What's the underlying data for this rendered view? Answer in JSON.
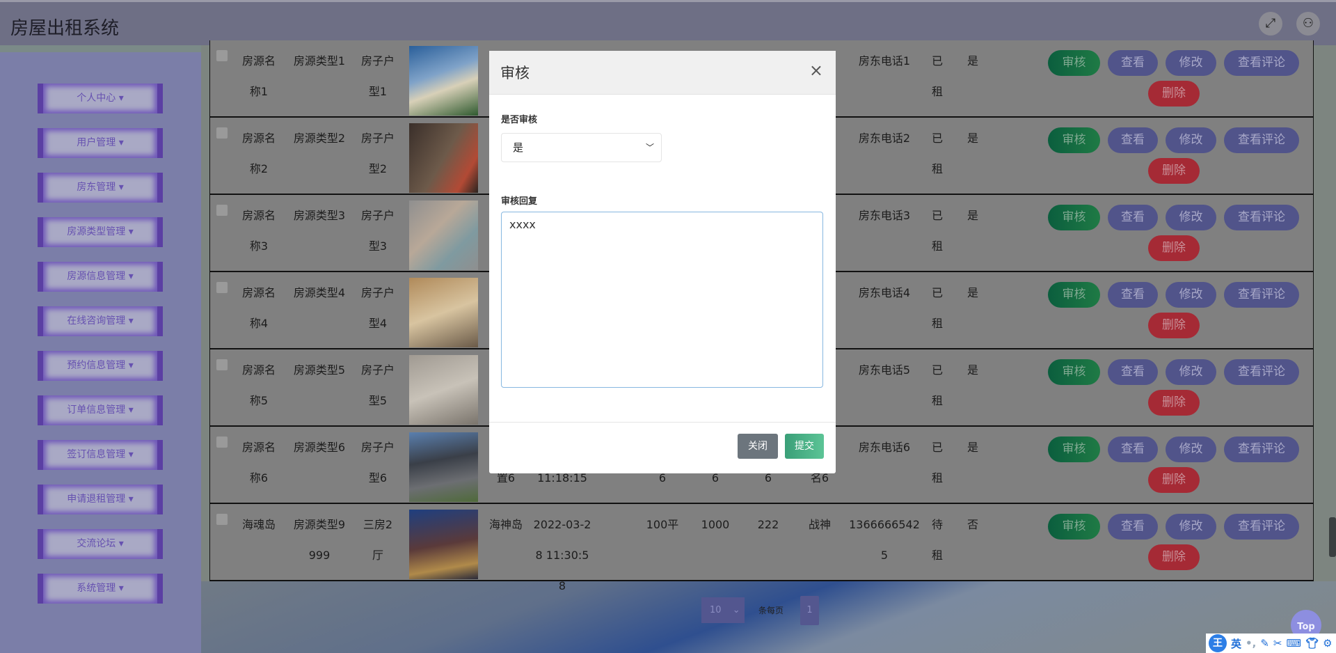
{
  "header": {
    "title": "房屋出租系统",
    "icons": [
      "fullscreen-icon",
      "user-icon"
    ]
  },
  "sidebar": {
    "items": [
      {
        "label": "个人中心 ▾"
      },
      {
        "label": "用户管理 ▾"
      },
      {
        "label": "房东管理 ▾"
      },
      {
        "label": "房源类型管理 ▾"
      },
      {
        "label": "房源信息管理 ▾"
      },
      {
        "label": "在线咨询管理 ▾"
      },
      {
        "label": "预约信息管理 ▾"
      },
      {
        "label": "订单信息管理 ▾"
      },
      {
        "label": "签订信息管理 ▾"
      },
      {
        "label": "申请退租管理 ▾"
      },
      {
        "label": "交流论坛 ▾"
      },
      {
        "label": "系统管理 ▾"
      }
    ]
  },
  "table": {
    "actions": {
      "audit": "审核",
      "view": "查看",
      "edit": "修改",
      "comments": "查看评论",
      "delete": "删除"
    },
    "rows": [
      {
        "cells": [
          "房源名称1",
          "房源类型1",
          "房子户型1",
          "",
          "",
          "",
          "",
          "",
          "",
          "房东电话1",
          "已租",
          "是"
        ],
        "image": "castle-house"
      },
      {
        "cells": [
          "房源名称2",
          "房源类型2",
          "房子户型2",
          "",
          "",
          "",
          "",
          "",
          "",
          "房东电话2",
          "已租",
          "是"
        ],
        "image": "bedroom"
      },
      {
        "cells": [
          "房源名称3",
          "房源类型3",
          "房子户型3",
          "",
          "",
          "",
          "",
          "",
          "",
          "房东电话3",
          "已租",
          "是"
        ],
        "image": "floorplan"
      },
      {
        "cells": [
          "房源名称4",
          "房源类型4",
          "房子户型4",
          "",
          "",
          "",
          "",
          "",
          "",
          "房东电话4",
          "已租",
          "是"
        ],
        "image": "living-room"
      },
      {
        "cells": [
          "房源名称5",
          "房源类型5",
          "房子户型5",
          "",
          "",
          "",
          "",
          "",
          "",
          "房东电话5",
          "已租",
          "是"
        ],
        "image": "empty-room"
      },
      {
        "cells": [
          "房源名称6",
          "房源类型6",
          "房子户型6",
          "置6",
          "11:18:15",
          "6",
          "6",
          "6",
          "名6",
          "房东电话6",
          "已租",
          "是"
        ],
        "image": "office-building"
      },
      {
        "cells": [
          "海魂岛",
          "房源类型9999",
          "三房2厅",
          "海神岛",
          "2022-03-28 11:30:58",
          "100平",
          "1000",
          "222",
          "战神",
          "13666665425",
          "待租",
          "否"
        ],
        "image": "hotel-tower"
      }
    ]
  },
  "modal": {
    "title": "审核",
    "close": "×",
    "audit_label": "是否审核",
    "audit_value": "是",
    "reply_label": "审核回复",
    "reply_value": "xxxx",
    "close_button": "关闭",
    "submit_button": "提交"
  },
  "pagination": {
    "page_size": "10",
    "page_size_suffix": "条每页",
    "current_page": "1"
  },
  "back_to_top": "Top",
  "ime_toolbar": {
    "logo": "王",
    "mode": "英"
  },
  "colors": {
    "audit": "#1f7a45",
    "action": "#51548a",
    "delete": "#a52a35",
    "submit": "#3aa57c",
    "close": "#6c757d"
  }
}
